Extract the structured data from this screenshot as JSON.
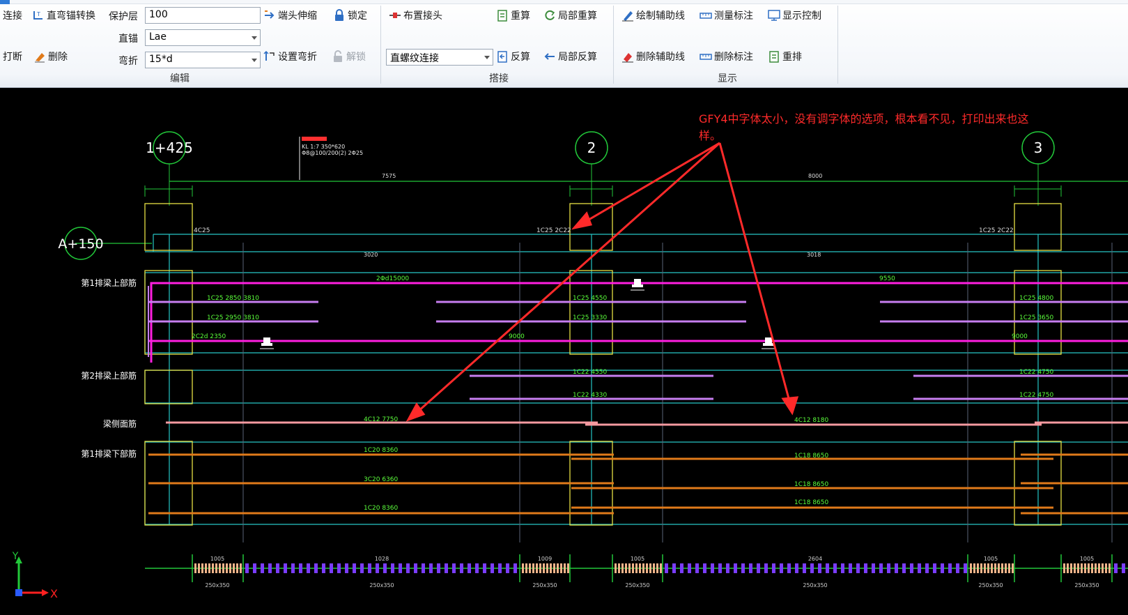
{
  "ribbon": {
    "edit": {
      "connect": "连接",
      "straight_bend_convert": "直弯锚转换",
      "cover_label": "保护层",
      "cover_value": "100",
      "end_extend": "端头伸缩",
      "lock": "锁定",
      "straight_anchor_label": "直锚",
      "straight_anchor_value": "Lae",
      "break": "打断",
      "delete": "删除",
      "bend_label": "弯折",
      "bend_value": "15*d",
      "set_bend": "设置弯折",
      "unlock": "解锁",
      "group_name": "编辑"
    },
    "splice": {
      "place_splice": "布置接头",
      "splice_type": "直螺纹连接",
      "group_name": "搭接"
    },
    "calc": {
      "recalc": "重算",
      "local_recalc": "局部重算",
      "reverse": "反算",
      "local_reverse": "局部反算"
    },
    "display": {
      "draw_aux": "绘制辅助线",
      "measure_dim": "测量标注",
      "display_control": "显示控制",
      "delete_aux": "删除辅助线",
      "delete_dim": "删除标注",
      "rearrange": "重排",
      "group_name": "显示"
    }
  },
  "drawing": {
    "axes": [
      {
        "label": "1+425"
      },
      {
        "label": "2"
      },
      {
        "label": "3"
      }
    ],
    "row_axis": "A+150",
    "row_labels": {
      "top_bar_1": "第1排梁上部筋",
      "top_bar_2": "第2排梁上部筋",
      "side_bar": "梁侧面筋",
      "bottom_bar_1": "第1排梁下部筋"
    },
    "span_dims": [
      "7575",
      "8000"
    ],
    "clear_dims": [
      "3020",
      "3018"
    ],
    "beam_note": [
      "KL 1:7 350*620",
      "Φ8@100/200(2) 2Φ25"
    ],
    "small_labels": {
      "top_a": "4C25",
      "top_b": "1C25 2C22",
      "top_c": "1C25 2C22",
      "r1a": "2Φd15000",
      "r1b": "9550",
      "r2a": "1C25 2850 3810",
      "r2b": "1C25 4550",
      "r2c": "1C25 4800",
      "r3a": "1C25 2950 3810",
      "r3b": "1C25 3330",
      "r3c": "1C25 3650",
      "r4a": "2C2d 2350",
      "r4b": "9000",
      "r4c": "9000",
      "s2a": "1C22 4550",
      "s2b": "1C22 4750",
      "s2c": "1C22 4330",
      "s2d": "1C22 4750",
      "side_a": "4C12 7750",
      "side_b": "4C12 8180",
      "b1": "1C20 8360",
      "b2": "1C18 8650",
      "b3": "3C20 6360",
      "b4": "1C18 8650",
      "b5": "1C20 8360",
      "b6": "1C18 8650"
    },
    "strip_labels": [
      "1005",
      "1028",
      "1009",
      "1005",
      "2604",
      "1005",
      "1005"
    ],
    "strip_sections": [
      "250x350",
      "250x350",
      "250x350",
      "250x350",
      "250x350",
      "250x350",
      "250x350"
    ],
    "annotation": "GFY4中字体太小，没有调字体的选项，根本看不见，打印出来也这样。",
    "ucs_x": "X",
    "ucs_y": "Y"
  },
  "colors": {
    "grid_green": "#22c83a",
    "beam_cyan": "#26c6c6",
    "column_yellow": "#e8e044",
    "magenta_bar": "#ff1fe0",
    "violet_bar": "#c77ef0",
    "pink_bar": "#f49aa0",
    "orange_bar": "#e07a1a",
    "annotation_red": "#ff2a2a",
    "label_green": "#5cff3c"
  }
}
